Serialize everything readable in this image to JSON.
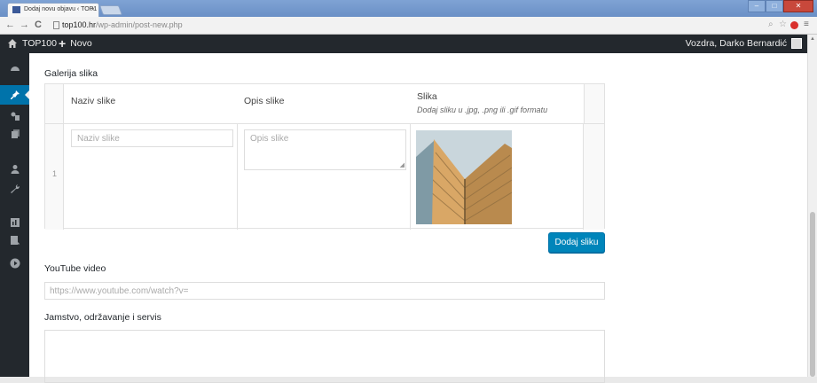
{
  "browser": {
    "tab_title": "Dodaj novu objavu ‹ TOP1",
    "tab_close": "×",
    "url_host": "top100.hr",
    "url_path": "/wp-admin/post-new.php",
    "nav_back": "←",
    "nav_forward": "→",
    "nav_reload": "C",
    "toolbar_icons": [
      "magnifier-icon",
      "star-icon",
      "adblock-icon",
      "menu-icon"
    ]
  },
  "adminbar": {
    "site_name": "TOP100",
    "new_label": "Novo",
    "plus": "+",
    "user_greeting": "Vozdra, Darko Bernardić"
  },
  "sidebar": {
    "items": [
      {
        "icon": "dashboard-icon",
        "active": false
      },
      {
        "icon": "pin-icon",
        "active": true
      },
      {
        "icon": "media-icon",
        "active": false
      },
      {
        "icon": "pages-icon",
        "active": false
      },
      {
        "icon": "users-icon",
        "active": false
      },
      {
        "icon": "tools-icon",
        "active": false
      },
      {
        "icon": "reports-icon",
        "active": false
      },
      {
        "icon": "forms-icon",
        "active": false
      },
      {
        "icon": "play-icon",
        "active": false
      }
    ]
  },
  "gallery": {
    "title": "Galerija slika",
    "headers": {
      "naziv": "Naziv slike",
      "opis": "Opis slike",
      "slika": "Slika",
      "slika_hint": "Dodaj sliku u .jpg, .png ili .gif formatu"
    },
    "rows": [
      {
        "num": "1",
        "naziv_placeholder": "Naziv slike",
        "opis_placeholder": "Opis slike"
      }
    ],
    "add_button": "Dodaj sliku"
  },
  "youtube": {
    "title": "YouTube video",
    "placeholder": "https://www.youtube.com/watch?v="
  },
  "warranty": {
    "title": "Jamstvo, održavanje i servis"
  },
  "colors": {
    "adminbar_bg": "#23282d",
    "accent": "#0073aa",
    "button": "#0085ba"
  }
}
